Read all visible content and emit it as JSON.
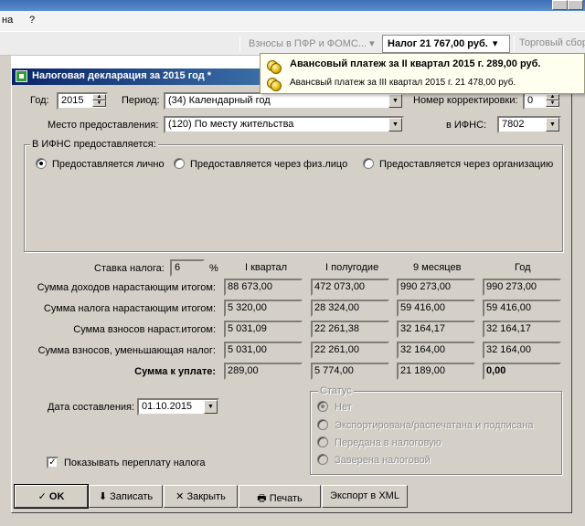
{
  "menubar": {
    "item1": "на",
    "item2": "?"
  },
  "toolbar": {
    "pfr_label": "Взносы в ПФР и ФОМС...",
    "pfr_arrow": "▾",
    "tax_label": "Налог 21 767,00 руб.",
    "tax_arrow": "▾",
    "trade_label": "Торговый сбор"
  },
  "notifications": [
    {
      "text": "Авансовый платеж за II квартал 2015 г. 289,00 руб.",
      "bold": true
    },
    {
      "text": "Авансвый платеж за III квартал 2015 г. 21 478,00 руб.",
      "bold": false
    }
  ],
  "dialog": {
    "title": "Налоговая декларация за 2015 год *",
    "year_label": "Год:",
    "year_value": "2015",
    "period_label": "Период:",
    "period_value": "(34) Календарный год",
    "correction_label": "Номер корректировки:",
    "correction_value": "0",
    "place_label": "Место предоставления:",
    "place_value": "(120) По месту жительства",
    "ifns_label": "в ИФНС:",
    "ifns_value": "7802",
    "submit_group_title": "В ИФНС предоставляется:",
    "submit_options": [
      "Предоставляется лично",
      "Предоставляется через физ.лицо",
      "Предоставляется через организацию"
    ],
    "rate_label": "Ставка налога:",
    "rate_value": "6",
    "rate_unit": "%",
    "columns": [
      "I квартал",
      "I полугодие",
      "9 месяцев",
      "Год"
    ],
    "rows": [
      {
        "label": "Сумма доходов нарастающим итогом:",
        "values": [
          "88 673,00",
          "472 073,00",
          "990 273,00",
          "990 273,00"
        ]
      },
      {
        "label": "Сумма налога нарастающим итогом:",
        "values": [
          "5 320,00",
          "28 324,00",
          "59 416,00",
          "59 416,00"
        ]
      },
      {
        "label": "Сумма взносов нараст.итогом:",
        "values": [
          "5 031,09",
          "22 261,38",
          "32 164,17",
          "32 164,17"
        ]
      },
      {
        "label": "Сумма взносов, уменьшающая налог:",
        "values": [
          "5 031,00",
          "22 261,00",
          "32 164,00",
          "32 164,00"
        ]
      },
      {
        "label": "Сумма к уплате:",
        "values": [
          "289,00",
          "5 774,00",
          "21 189,00",
          "0,00"
        ]
      }
    ],
    "date_label": "Дата составления:",
    "date_value": "01.10.2015",
    "status_title": "Статус",
    "status_options": [
      "Нет",
      "Экспортирована/распечатана и подписана",
      "Передана в налоговую",
      "Заверена налоговой"
    ],
    "overpay_label": "Показывать переплату налога",
    "overpay_check": "✓"
  },
  "buttons": {
    "ok": "✓ OK",
    "save": "⬇ Записать",
    "close": "✕ Закрыть",
    "print": "Печать",
    "export": "Экспорт в XML"
  },
  "colors": {
    "dialog_bg": "#d4d0c8",
    "titlebar_start": "#0a246a",
    "titlebar_end": "#3a6ea5",
    "popup_bg": "#fffff0"
  }
}
